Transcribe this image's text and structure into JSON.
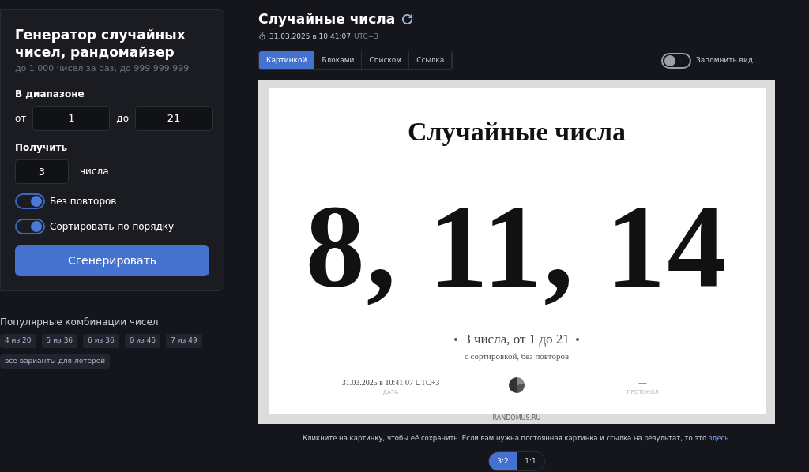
{
  "generator": {
    "title": "Генератор случайных чисел, рандомайзер",
    "subtitle": "до 1 000 чисел за раз, до 999 999 999",
    "range_label": "В диапазоне",
    "from_label": "от",
    "from_value": "1",
    "to_label": "до",
    "to_value": "21",
    "get_label": "Получить",
    "count_value": "3",
    "count_unit": "числа",
    "toggles": [
      {
        "label": "Без повторов",
        "on": true
      },
      {
        "label": "Сортировать по порядку",
        "on": true
      }
    ],
    "button": "Сгенерировать"
  },
  "popular": {
    "title": "Популярные комбинации чисел",
    "chips": [
      "4 из 20",
      "5 из 36",
      "6 из 36",
      "6 из 45",
      "7 из 49",
      "все варианты для лотерей"
    ]
  },
  "result": {
    "title": "Случайные числа",
    "timestamp": "31.03.2025 в 10:41:07",
    "timezone": "UTC+3",
    "tabs": [
      {
        "label": "Картинкой",
        "selected": true
      },
      {
        "label": "Блоками",
        "selected": false
      },
      {
        "label": "Списком",
        "selected": false
      },
      {
        "label": "Ссылка",
        "selected": false
      }
    ],
    "remember": {
      "label": "Запомнить вид",
      "on": false
    },
    "image": {
      "title": "Случайные числа",
      "numbers": "8, 11, 14",
      "summary": "3 числа, от 1 до 21",
      "details": "с сортировкой, без повторов",
      "date_value": "31.03.2025 в 10:41:07 UTC+3",
      "date_label": "ДАТА",
      "protocol_value": "—",
      "protocol_label": "ПРОТОКОЛ",
      "site": "RANDOMUS.RU"
    },
    "hint": "Кликните на картинку, чтобы её сохранить. Если вам нужна постоянная картинка и ссылка на результат, то это ",
    "hint_link": "здесь",
    "hint_end": ".",
    "ratios": [
      {
        "label": "3:2",
        "selected": true
      },
      {
        "label": "1:1",
        "selected": false
      }
    ]
  }
}
